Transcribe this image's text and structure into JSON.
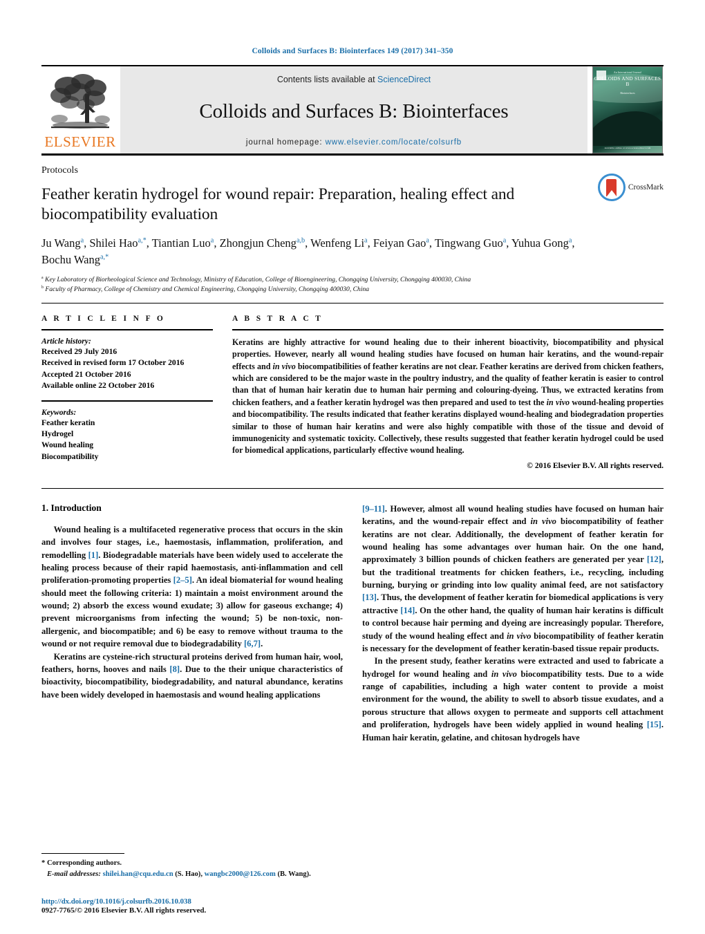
{
  "running_head": "Colloids and Surfaces B: Biointerfaces 149 (2017) 341–350",
  "colors": {
    "link_blue": "#1a6ea8",
    "elsevier_orange": "#E87722",
    "crossmark_blue": "#3b8fd0",
    "crossmark_red": "#d93a2b",
    "masthead_grey": "#e8e8e8"
  },
  "masthead": {
    "publisher": "ELSEVIER",
    "contents_prefix": "Contents lists available at",
    "contents_link": "ScienceDirect",
    "journal_name": "Colloids and Surfaces B: Biointerfaces",
    "homepage_label": "journal homepage:",
    "homepage_url": "www.elsevier.com/locate/colsurfb",
    "cover": {
      "top_small": "An International Journal",
      "title": "COLLOIDS AND SURFACES B",
      "sub": "Biointerfaces",
      "bottom": "Available online at www.sciencedirect.com"
    }
  },
  "article": {
    "section_type": "Protocols",
    "title": "Feather keratin hydrogel for wound repair: Preparation, healing effect and biocompatibility evaluation",
    "crossmark_label": "CrossMark",
    "authors_html": "Ju Wang<sup>a</sup>, Shilei Hao<sup>a,*</sup>, Tiantian Luo<sup>a</sup>, Zhongjun Cheng<sup>a,b</sup>, Wenfeng Li<sup>a</sup>, Feiyan Gao<sup>a</sup>, Tingwang Guo<sup>a</sup>, Yuhua Gong<sup>a</sup>, Bochu Wang<sup>a,*</sup>",
    "affiliation_a": "Key Laboratory of Biorheological Science and Technology, Ministry of Education, College of Bioengineering, Chongqing University, Chongqing 400030, China",
    "affiliation_b": "Faculty of Pharmacy, College of Chemistry and Chemical Engineering, Chongqing University, Chongqing 400030, China"
  },
  "article_info": {
    "label": "A R T I C L E   I N F O",
    "history_title": "Article history:",
    "history": [
      "Received 29 July 2016",
      "Received in revised form 17 October 2016",
      "Accepted 21 October 2016",
      "Available online 22 October 2016"
    ],
    "keywords_title": "Keywords:",
    "keywords": [
      "Feather keratin",
      "Hydrogel",
      "Wound healing",
      "Biocompatibility"
    ]
  },
  "abstract": {
    "label": "A B S T R A C T",
    "text_html": "Keratins are highly attractive for wound healing due to their inherent bioactivity, biocompatibility and physical properties. However, nearly all wound healing studies have focused on human hair keratins, and the wound-repair effects and <i>in vivo</i> biocompatibilities of feather keratins are not clear. Feather keratins are derived from chicken feathers, which are considered to be the major waste in the poultry industry, and the quality of feather keratin is easier to control than that of human hair keratin due to human hair perming and colouring-dyeing. Thus, we extracted keratins from chicken feathers, and a feather keratin hydrogel was then prepared and used to test the <i>in vivo</i> wound-healing properties and biocompatibility. The results indicated that feather keratins displayed wound-healing and biodegradation properties similar to those of human hair keratins and were also highly compatible with those of the tissue and devoid of immunogenicity and systematic toxicity. Collectively, these results suggested that feather keratin hydrogel could be used for biomedical applications, particularly effective wound healing.",
    "copyright": "© 2016 Elsevier B.V. All rights reserved."
  },
  "intro": {
    "heading": "1.  Introduction",
    "left_p1_html": "Wound healing is a multifaceted regenerative process that occurs in the skin and involves four stages, i.e., haemostasis, inflammation, proliferation, and remodelling <span class=\"ref\">[1]</span>. Biodegradable materials have been widely used to accelerate the healing process because of their rapid haemostasis, anti-inflammation and cell proliferation-promoting properties <span class=\"ref\">[2–5]</span>. An ideal biomaterial for wound healing should meet the following criteria: 1) maintain a moist environment around the wound; 2) absorb the excess wound exudate; 3) allow for gaseous exchange; 4) prevent microorganisms from infecting the wound; 5) be non-toxic, non-allergenic, and biocompatible; and 6) be easy to remove without trauma to the wound or not require removal due to biodegradability <span class=\"ref\">[6,7]</span>.",
    "left_p2_html": "Keratins are cysteine-rich structural proteins derived from human hair, wool, feathers, horns, hooves and nails <span class=\"ref\">[8]</span>. Due to the their unique characteristics of bioactivity, biocompatibility, biodegradability, and natural abundance, keratins have been widely developed in haemostasis and wound healing applications",
    "right_p1_html": "<span class=\"ref\">[9–11]</span>. However, almost all wound healing studies have focused on human hair keratins, and the wound-repair effect and <i>in vivo</i> biocompatibility of feather keratins are not clear. Additionally, the development of feather keratin for wound healing has some advantages over human hair. On the one hand, approximately 3 billion pounds of chicken feathers are generated per year <span class=\"ref\">[12]</span>, but the traditional treatments for chicken feathers, i.e., recycling, including burning, burying or grinding into low quality animal feed, are not satisfactory <span class=\"ref\">[13]</span>. Thus, the development of feather keratin for biomedical applications is very attractive <span class=\"ref\">[14]</span>. On the other hand, the quality of human hair keratins is difficult to control because hair perming and dyeing are increasingly popular. Therefore, study of the wound healing effect and <i>in vivo</i> biocompatibility of feather keratin is necessary for the development of feather keratin-based tissue repair products.",
    "right_p2_html": "In the present study, feather keratins were extracted and used to fabricate a hydrogel for wound healing and <i>in vivo</i> biocompatibility tests. Due to a wide range of capabilities, including a high water content to provide a moist environment for the wound, the ability to swell to absorb tissue exudates, and a porous structure that allows oxygen to permeate and supports cell attachment and proliferation, hydrogels have been widely applied in wound healing <span class=\"ref\">[15]</span>. Human hair keratin, gelatine, and chitosan hydrogels have"
  },
  "footnotes": {
    "corresponding": "*  Corresponding authors.",
    "email_label": "E-mail addresses:",
    "email_1": "shilei.han@cqu.edu.cn",
    "email_1_owner": "(S. Hao),",
    "email_2": "wangbc2000@126.com",
    "email_2_owner": "(B. Wang).",
    "doi": "http://dx.doi.org/10.1016/j.colsurfb.2016.10.038",
    "issn": "0927-7765/© 2016 Elsevier B.V. All rights reserved."
  }
}
